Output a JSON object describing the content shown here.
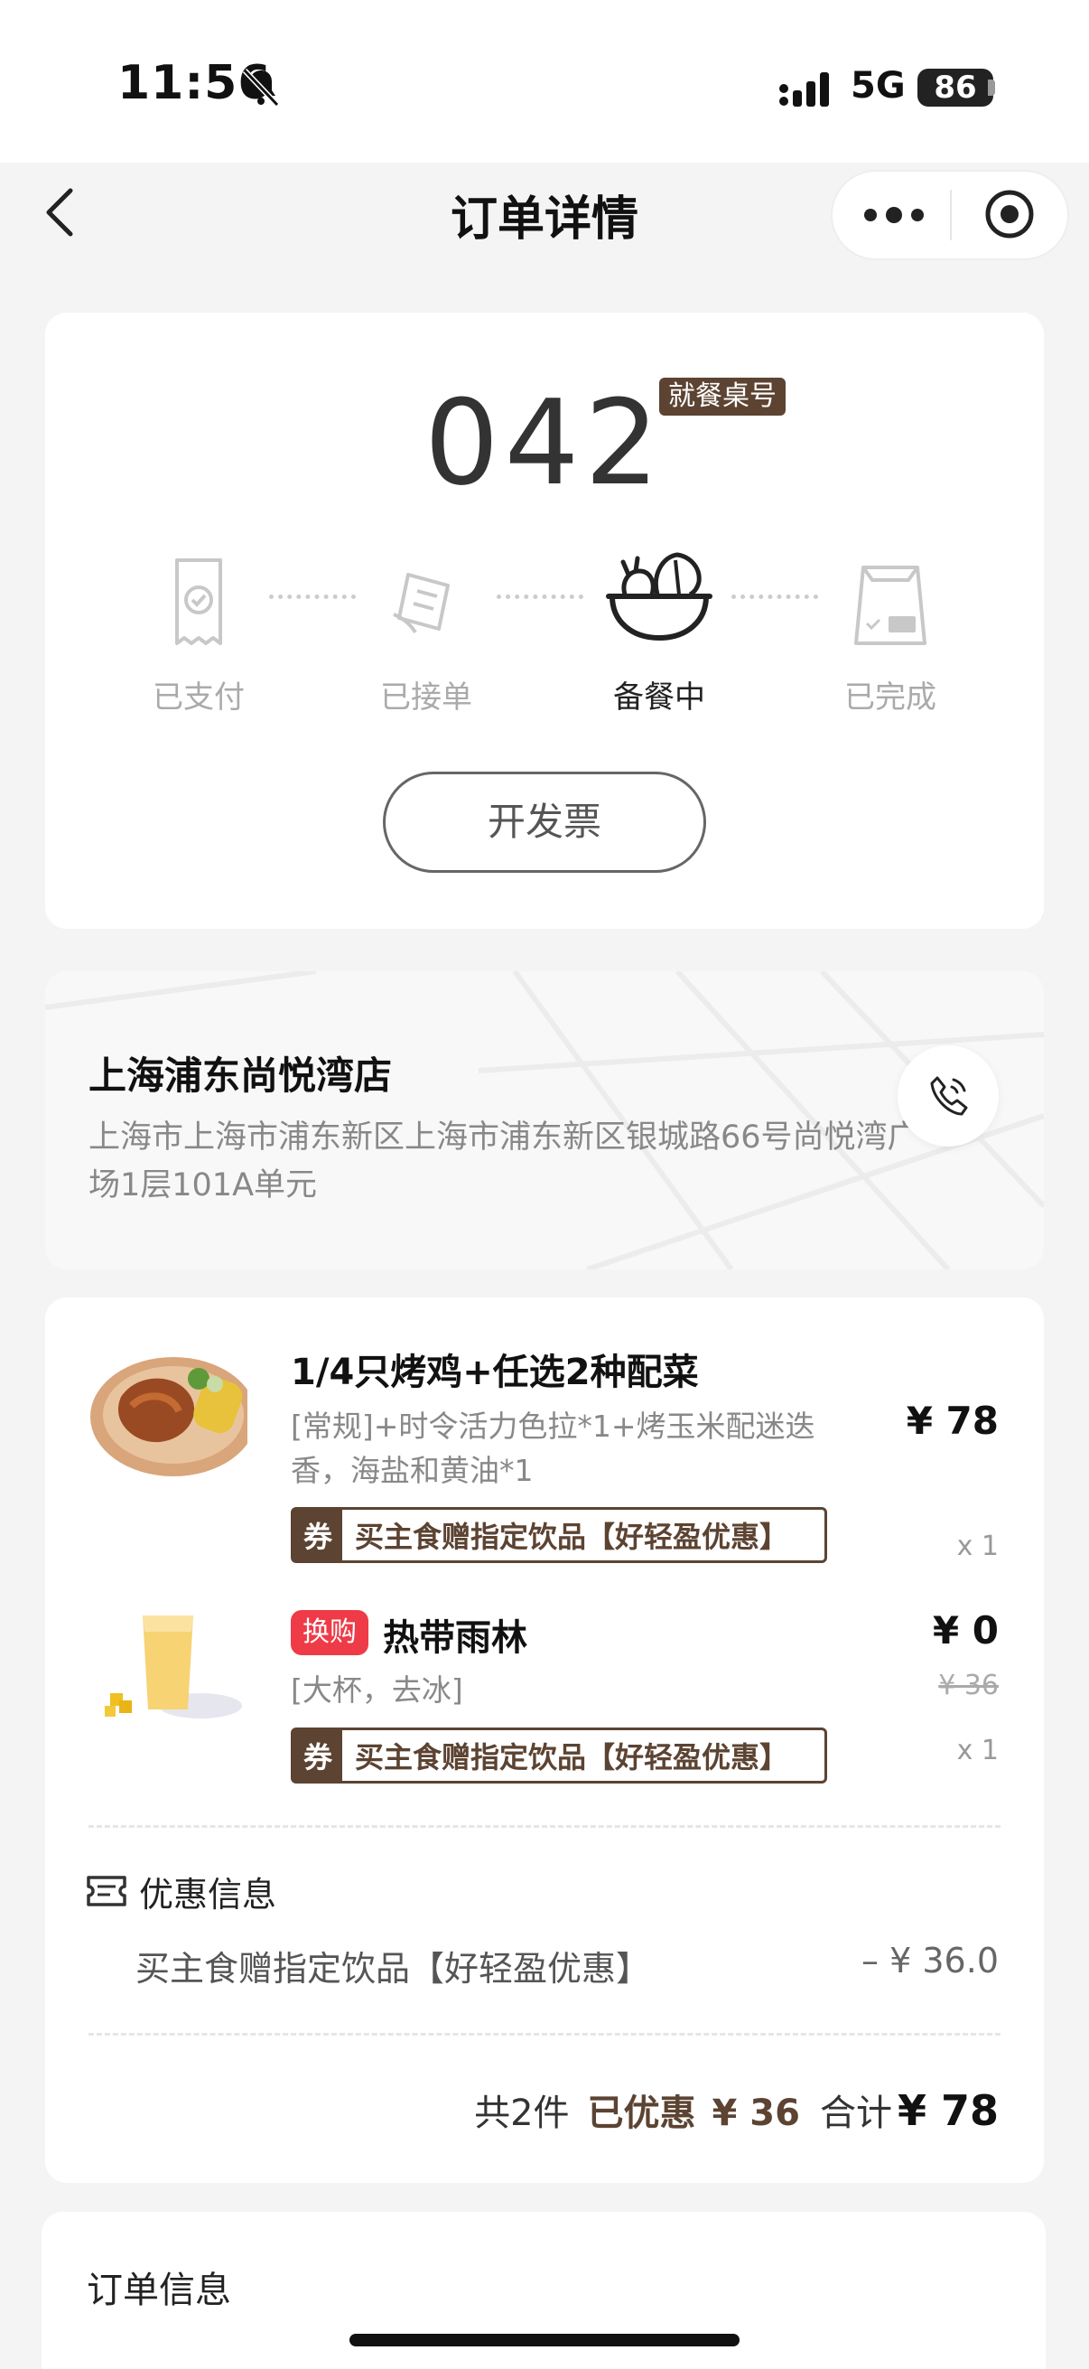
{
  "status_bar": {
    "time": "11:56",
    "network": "5G",
    "battery": "86"
  },
  "nav": {
    "title": "订单详情"
  },
  "status_card": {
    "table_number": "042",
    "table_badge": "就餐桌号",
    "steps": [
      {
        "label": "已支付",
        "state": "done"
      },
      {
        "label": "已接单",
        "state": "done"
      },
      {
        "label": "备餐中",
        "state": "active"
      },
      {
        "label": "已完成",
        "state": "pending"
      }
    ],
    "invoice_label": "开发票"
  },
  "store": {
    "name": "上海浦东尚悦湾店",
    "address": "上海市上海市浦东新区上海市浦东新区银城路66号尚悦湾广场1层101A单元"
  },
  "items": [
    {
      "name": "1/4只烤鸡+任选2种配菜",
      "spec": "[常规]+时令活力色拉*1+烤玉米配迷迭香，海盐和黄油*1",
      "price": "¥ 78",
      "qty": "x 1",
      "coupon_tag": "券",
      "coupon_text": "买主食赠指定饮品【好轻盈优惠】"
    },
    {
      "tag": "换购",
      "name": "热带雨林",
      "spec": "[大杯，去冰]",
      "price": "¥ 0",
      "original_price": "¥ 36",
      "qty": "x 1",
      "coupon_tag": "券",
      "coupon_text": "买主食赠指定饮品【好轻盈优惠】"
    }
  ],
  "discount": {
    "title": "优惠信息",
    "name": "买主食赠指定饮品【好轻盈优惠】",
    "amount": "– ¥ 36.0"
  },
  "summary": {
    "count": "共2件",
    "discount_label": "已优惠",
    "discount_value": "¥ 36",
    "total_label": "合计",
    "total_value": "¥ 78"
  },
  "order_info": {
    "title": "订单信息"
  },
  "colors": {
    "brand_brown": "#5c4332",
    "swap_red": "#ee3b47"
  }
}
